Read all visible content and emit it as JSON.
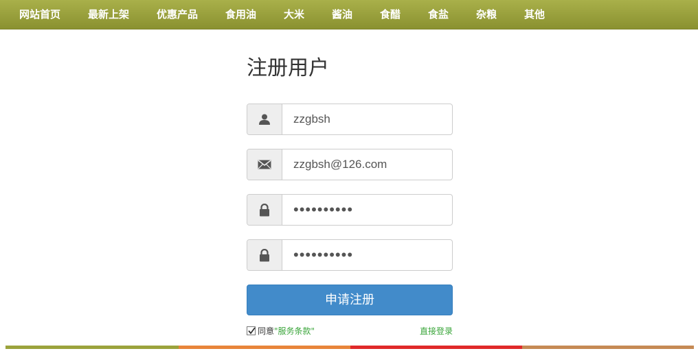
{
  "nav": {
    "items": [
      {
        "label": "网站首页"
      },
      {
        "label": "最新上架"
      },
      {
        "label": "优惠产品"
      },
      {
        "label": "食用油"
      },
      {
        "label": "大米"
      },
      {
        "label": "酱油"
      },
      {
        "label": "食醋"
      },
      {
        "label": "食盐"
      },
      {
        "label": "杂粮"
      },
      {
        "label": "其他"
      }
    ]
  },
  "form": {
    "title": "注册用户",
    "username": "zzgbsh",
    "email": "zzgbsh@126.com",
    "password": "••••••••••",
    "confirm_password": "••••••••••",
    "submit_label": "申请注册",
    "agree_label": "同意",
    "terms_label": "\"服务条款\"",
    "login_label": "直接登录",
    "agree_checked": true
  },
  "icons": {
    "username": "user-icon",
    "email": "envelope-icon",
    "password": "lock-icon",
    "confirm_password": "lock-icon"
  },
  "colors": {
    "nav_background": "#9ba33c",
    "primary_button": "#428bca",
    "link": "#3aa53a",
    "footer_bar": [
      "#9ba33c",
      "#e8853a",
      "#e02a2a",
      "#c68a55"
    ]
  }
}
